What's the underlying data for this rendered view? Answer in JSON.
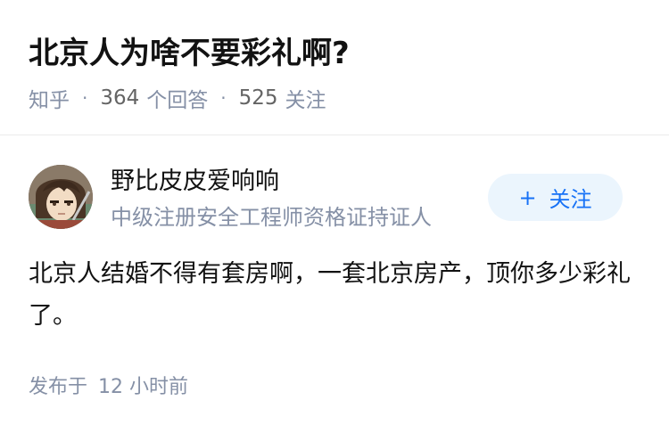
{
  "question": {
    "title": "北京人为啥不要彩礼啊?",
    "source": "知乎",
    "answer_count": "364",
    "answer_label": "个回答",
    "follower_count": "525",
    "follower_label": "关注",
    "separator": "·"
  },
  "author": {
    "name": "野比皮皮爱响响",
    "bio": "中级注册安全工程师资格证持证人",
    "follow_plus": "+",
    "follow_label": "关注"
  },
  "answer": {
    "content": "北京人结婚不得有套房啊，一套北京房产，顶你多少彩礼了。",
    "publish_prefix": "发布于",
    "publish_time": "12 小时前"
  },
  "colors": {
    "accent": "#1772f6",
    "follow_bg": "#ebf5fd",
    "meta_text": "#8590a6",
    "title_text": "#121212"
  },
  "icons": {
    "avatar": "anime-character-avatar"
  }
}
